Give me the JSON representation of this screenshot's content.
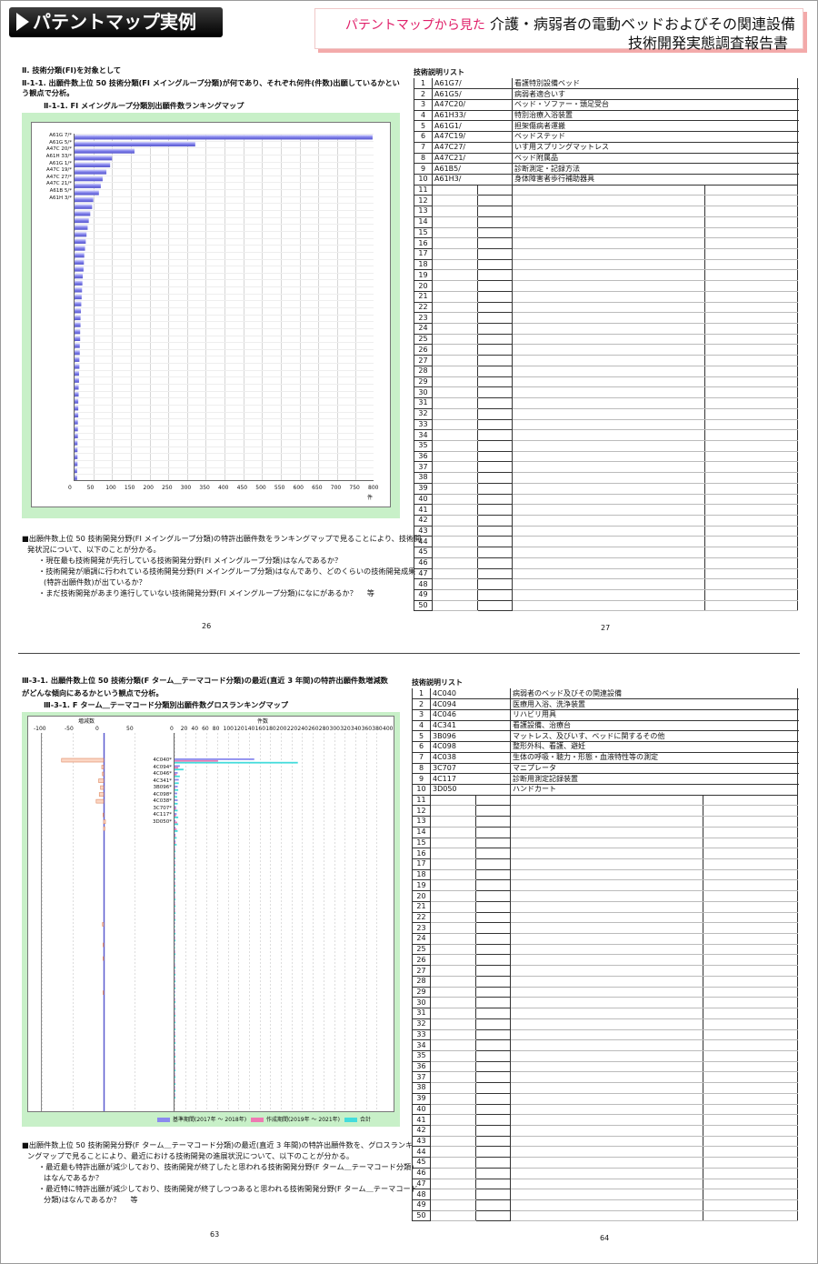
{
  "header": {
    "badge": "パテントマップ実例",
    "title_prefix": "パテントマップから見た",
    "title_main": "介護・病弱者の電動ベッドおよびその関連設備",
    "title_sub": "技術開発実態調査報告書"
  },
  "top": {
    "heading": "Ⅱ. 技術分類(FI)を対象として",
    "sub1_line1": "Ⅱ-1-1. 出願件数上位 50 技術分類(FI メイングループ分類)が何であり、それぞれ何件(件数)出願しているかとい",
    "sub1_line2": "う観点で分析。",
    "chart_title": "Ⅱ-1-1. FI メイングループ分類別出願件数ランキングマップ",
    "notes": [
      "■出願件数上位 50 技術開発分野(FI メイングループ分類)の特許出願件数をランキングマップで見ることにより、技術開",
      "発状況について、以下のことが分かる。",
      "・現在最も技術開発が先行している技術開発分野(FI メイングループ分類)はなんであるか？",
      "・技術開発が順調に行われている技術開発分野(FI メイングループ分類)はなんであり、どのくらいの技術開発成果",
      "(特許出願件数)が出ているか？",
      "・まだ技術開発があまり進行していない技術開発分野(FI メイングループ分類)になにがあるか？　 等"
    ],
    "page_left": "26",
    "page_right": "27",
    "list_title": "技術説明リスト",
    "list": [
      {
        "code": "A61G7/",
        "desc": "看護特別設備ベッド"
      },
      {
        "code": "A61G5/",
        "desc": "病弱者適合いす"
      },
      {
        "code": "A47C20/",
        "desc": "ベッド・ソファー・頭足受台"
      },
      {
        "code": "A61H33/",
        "desc": "特別治療入浴装置"
      },
      {
        "code": "A61G1/",
        "desc": "担架傷病者運搬"
      },
      {
        "code": "A47C19/",
        "desc": "ベッドステッド"
      },
      {
        "code": "A47C27/",
        "desc": "いす用スプリングマットレス"
      },
      {
        "code": "A47C21/",
        "desc": "ベッド附属品"
      },
      {
        "code": "A61B5/",
        "desc": "診断測定・記録方法"
      },
      {
        "code": "A61H3/",
        "desc": "身体障害者歩行補助器具"
      }
    ]
  },
  "bottom": {
    "heading_line1": "Ⅲ-3-1. 出願件数上位 50 技術分類(F ターム＿テーマコード分類)の最近(直近 3 年間)の特許出願件数増減数",
    "heading_line2": "がどんな傾向にあるかという観点で分析。",
    "chart_title": "Ⅲ-3-1. F ターム＿テーマコード分類別出願件数グロスランキングマップ",
    "notes": [
      "■出願件数上位 50 技術開発分野(F ターム＿テーマコード分類)の最近(直近 3 年間)の特許出願件数を、グロスランキ",
      "ングマップで見ることにより、最近における技術開発の進展状況について、以下のことが分かる。",
      "・最近最も特許出願が減少しており、技術開発が終了したと思われる技術開発分野(F ターム＿テーマコード分類)",
      "はなんであるか？",
      "・最近特に特許出願が減少しており、技術開発が終了しつつあると思われる技術開発分野(F ターム＿テーマコード",
      "分類)はなんであるか？　 等"
    ],
    "page_left": "63",
    "page_right": "64",
    "list_title": "技術説明リスト",
    "list": [
      {
        "code": "4C040",
        "desc": "病弱者のベッド及びその関連設備"
      },
      {
        "code": "4C094",
        "desc": "医療用入浴、洗浄装置"
      },
      {
        "code": "4C046",
        "desc": "リハビリ用具"
      },
      {
        "code": "4C341",
        "desc": "看護設備、治療台"
      },
      {
        "code": "3B096",
        "desc": "マットレス、及びいす、ベッドに関するその他"
      },
      {
        "code": "4C098",
        "desc": "整形外科、看護、避妊"
      },
      {
        "code": "4C038",
        "desc": "生体の呼吸・聴力・形態・血液特性等の測定"
      },
      {
        "code": "3C707",
        "desc": "マニプレータ"
      },
      {
        "code": "4C117",
        "desc": "診断用測定記録装置"
      },
      {
        "code": "3D050",
        "desc": "ハンドカート"
      }
    ],
    "legend": {
      "base": "基準期間(2017年 ～ 2018年)",
      "recent": "作成期間(2019年 ～ 2021年)",
      "total": "合計"
    }
  },
  "chart_data": [
    {
      "type": "bar",
      "orientation": "horizontal",
      "xlabel": "件",
      "xlim": [
        0,
        800
      ],
      "xticks": [
        0,
        50,
        100,
        150,
        200,
        250,
        300,
        350,
        400,
        450,
        500,
        550,
        600,
        650,
        700,
        750,
        800
      ],
      "categories": [
        "A61G 7/*",
        "A61G 5/*",
        "A47C 20/*",
        "A61H 33/*",
        "A61G 1/*",
        "A47C 19/*",
        "A47C 27/*",
        "A47C 21/*",
        "A61B 5/*",
        "A61H 3/*"
      ],
      "values": [
        795,
        322,
        160,
        100,
        95,
        85,
        75,
        70,
        65,
        50,
        47,
        42,
        38,
        35,
        32,
        30,
        28,
        26,
        25,
        24,
        22,
        21,
        20,
        19,
        18,
        17,
        16,
        16,
        15,
        15,
        14,
        14,
        13,
        13,
        12,
        12,
        11,
        11,
        10,
        10,
        10,
        9,
        9,
        9,
        8,
        8,
        8,
        8,
        7,
        7
      ]
    },
    {
      "type": "bar",
      "orientation": "horizontal",
      "panel": "change",
      "xlabel": "増減数",
      "xlim": [
        -100,
        50
      ],
      "xticks": [
        -100,
        -50,
        0,
        50
      ],
      "categories": [
        "4C040*",
        "4C094*",
        "4C046*",
        "4C341*",
        "3B096*",
        "4C098*",
        "4C038*",
        "3C707*",
        "4C117*",
        "3D050*"
      ],
      "values": [
        -68,
        -3,
        -2,
        -8,
        -5,
        -7,
        -12,
        0,
        -1,
        3,
        2,
        0,
        0,
        0,
        0,
        0,
        0,
        0,
        0,
        0,
        0,
        0,
        0,
        0,
        -2,
        0,
        0,
        -1,
        0,
        -1,
        0,
        0,
        0,
        0,
        -1,
        0,
        0,
        0,
        0,
        0,
        0,
        0,
        0,
        0,
        0,
        0,
        0,
        0,
        0,
        0
      ]
    },
    {
      "type": "bar",
      "orientation": "horizontal",
      "panel": "counts",
      "xlabel": "件数",
      "xlim": [
        0,
        400
      ],
      "xticks": [
        0,
        20,
        40,
        60,
        80,
        100,
        120,
        140,
        160,
        180,
        200,
        220,
        240,
        260,
        280,
        300,
        320,
        340,
        360,
        380,
        400
      ],
      "categories": [
        "4C040*",
        "4C094*",
        "4C046*",
        "4C341*",
        "3B096*",
        "4C098*",
        "4C038*",
        "3C707*",
        "4C117*",
        "3D050*"
      ],
      "series": [
        {
          "name": "基準期間(2017年 ～ 2018年)",
          "values": [
            150,
            10,
            6,
            8,
            6,
            5,
            6,
            3,
            4,
            2,
            2,
            2,
            2,
            1,
            1,
            1,
            1,
            1,
            1,
            1,
            1,
            1,
            1,
            1,
            1,
            1,
            1,
            1,
            1,
            1,
            1,
            1,
            1,
            1,
            1,
            1,
            1,
            1,
            1,
            1,
            1,
            1,
            1,
            1,
            1,
            1,
            1,
            1,
            1,
            1
          ]
        },
        {
          "name": "作成期間(2019年 ～ 2021年)",
          "values": [
            82,
            7,
            4,
            0,
            1,
            0,
            0,
            3,
            3,
            5,
            4,
            2,
            2,
            1,
            1,
            1,
            1,
            1,
            1,
            1,
            1,
            1,
            1,
            1,
            0,
            1,
            1,
            0,
            1,
            0,
            1,
            1,
            1,
            1,
            0,
            1,
            1,
            1,
            1,
            1,
            1,
            1,
            1,
            1,
            1,
            1,
            1,
            1,
            1,
            1
          ]
        },
        {
          "name": "合計",
          "values": [
            232,
            17,
            10,
            8,
            7,
            5,
            6,
            6,
            7,
            7,
            6,
            4,
            4,
            2,
            2,
            2,
            2,
            2,
            2,
            2,
            2,
            2,
            2,
            2,
            1,
            2,
            2,
            1,
            2,
            1,
            2,
            2,
            2,
            2,
            1,
            2,
            2,
            2,
            2,
            2,
            2,
            2,
            2,
            2,
            2,
            2,
            2,
            2,
            2,
            2
          ]
        }
      ],
      "colors": {
        "base": "#8a8aee",
        "recent": "#ee7ab2",
        "total": "#44dcdc"
      }
    }
  ]
}
